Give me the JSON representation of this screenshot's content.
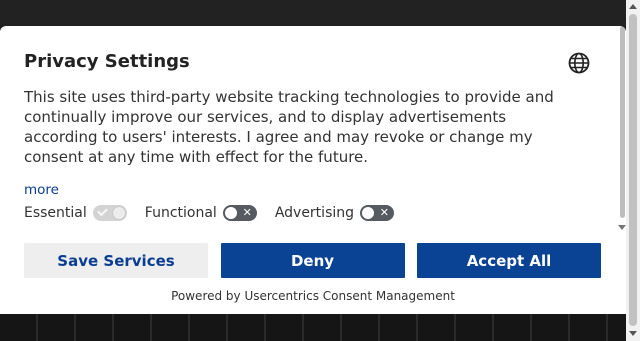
{
  "dialog": {
    "title": "Privacy Settings",
    "language_icon": "globe-icon",
    "description": "This site uses third-party website tracking technologies to provide and continually improve our services, and to display advertisements according to users' interests. I agree and may revoke or change my consent at any time with effect for the future.",
    "more_link": "more",
    "categories": [
      {
        "label": "Essential",
        "state": "on-disabled"
      },
      {
        "label": "Functional",
        "state": "off"
      },
      {
        "label": "Advertising",
        "state": "off"
      }
    ],
    "buttons": {
      "save": "Save Services",
      "deny": "Deny",
      "accept": "Accept All"
    },
    "powered_by": "Powered by Usercentrics Consent Management"
  },
  "colors": {
    "primary": "#0a4294",
    "secondary_bg": "#eeeeee",
    "link": "#0b3d91",
    "toggle_off": "#555b61"
  }
}
